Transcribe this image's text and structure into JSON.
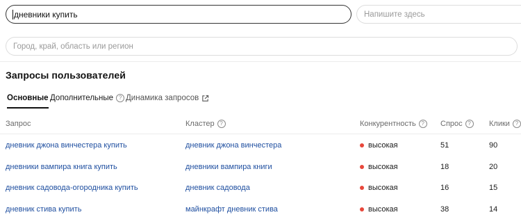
{
  "search": {
    "query": "дневники купить",
    "aux_placeholder": "Напишите здесь"
  },
  "region": {
    "placeholder": "Город, край, область или регион"
  },
  "section": {
    "title": "Запросы пользователей"
  },
  "tabs": [
    {
      "label": "Основные",
      "active": true
    },
    {
      "label": "Дополнительные",
      "help_icon": "question-circle-icon"
    },
    {
      "label": "Динамика запросов",
      "external_icon": "external-link-icon"
    }
  ],
  "table": {
    "columns": [
      "Запрос",
      "Кластер",
      "Конкурентность",
      "Спрос",
      "Клики"
    ],
    "rows": [
      {
        "query": "дневник джона винчестера купить",
        "cluster": "дневник джона винчестера",
        "competition": "высокая",
        "demand": "51",
        "clicks": "90"
      },
      {
        "query": "дневники вампира книга купить",
        "cluster": "дневники вампира книги",
        "competition": "высокая",
        "demand": "18",
        "clicks": "20"
      },
      {
        "query": "дневник садовода-огородника купить",
        "cluster": "дневник садовода",
        "competition": "высокая",
        "demand": "16",
        "clicks": "15"
      },
      {
        "query": "дневник стива купить",
        "cluster": "майнкрафт дневник стива",
        "competition": "высокая",
        "demand": "38",
        "clicks": "14"
      }
    ]
  },
  "colors": {
    "link": "#1f4fa0",
    "competition_high": "#e8473b"
  }
}
